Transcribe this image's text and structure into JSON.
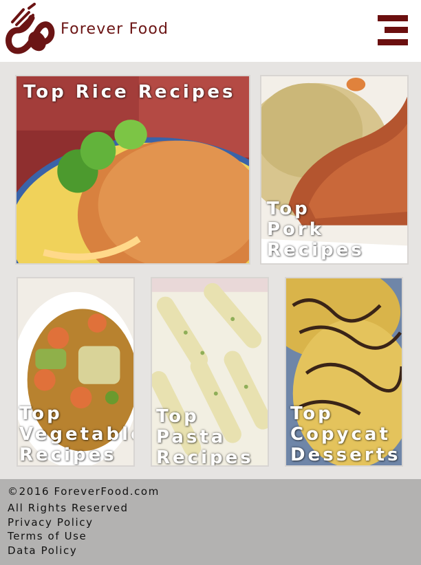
{
  "header": {
    "brand": "Forever Food",
    "logo_icon": "fork-spoon-logo-icon",
    "menu_icon": "hamburger-menu-icon",
    "brand_color": "#6b1414"
  },
  "tiles": [
    {
      "line1": "Top Rice Recipes",
      "line2": "",
      "line3": ""
    },
    {
      "line1": "Top",
      "line2": "Pork",
      "line3": "Recipes"
    },
    {
      "line1": "Top",
      "line2": "Vegetable",
      "line3": "Recipes"
    },
    {
      "line1": "Top",
      "line2": "Pasta",
      "line3": "Recipes"
    },
    {
      "line1": "Top",
      "line2": "Copycat",
      "line3": "Desserts"
    }
  ],
  "footer": {
    "copyright": "©2016 ForeverFood.com",
    "rights": "All Rights Reserved",
    "links": [
      "Privacy Policy",
      "Terms of Use",
      "Data Policy"
    ]
  }
}
